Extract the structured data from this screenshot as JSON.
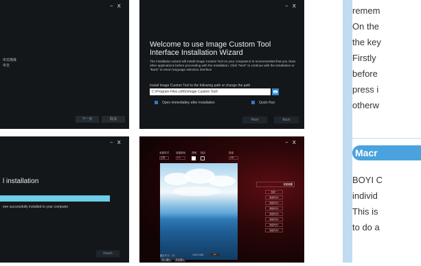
{
  "panel1": {
    "window_controls": [
      "–",
      "x"
    ],
    "language_lines": [
      "中文简体",
      "中文"
    ],
    "buttons": [
      "下一步",
      "取消"
    ]
  },
  "panel2": {
    "window_controls": [
      "–",
      "x"
    ],
    "title": "Welcome to use Image Custom Tool Interface Installation Wizard",
    "description": "The installation wizard will install Image Custom Tool on your computer,It is recommended that you close other applications before proceeding with the Installation,  Click \"Next\" to continue with the Installation or \"Back\" to return language selection interface",
    "path_label": "Install Image Custom Tool to the following path or change the path",
    "path_value": "C:\\Program Files (x86)\\Image Custom Tool\\",
    "checkbox_open": "Open immediatley after installation",
    "checkbox_quick": "Quick Run",
    "next_label": "Next",
    "back_label": "Back"
  },
  "panel3": {
    "window_controls": [
      "–",
      "x"
    ],
    "title": "l installation",
    "message": "een successfully installed to your computer",
    "progress": 1.0,
    "finish_label": "Finish"
  },
  "panel4": {
    "window_controls": [
      "–",
      "x"
    ],
    "toolbar_labels": [
      "准星样式",
      "准星颜色",
      "透明",
      "描边",
      "类型"
    ],
    "toolbar_values": [
      "正常",
      "1.0",
      "100"
    ],
    "side_header": "准星设置",
    "side_header_right": "十字准星",
    "side_items": [
      "准星一",
      "准星样式2",
      "准星样式3",
      "准星样式4",
      "准星样式5",
      "准星样式6",
      "准星样式7",
      "准星样式8"
    ],
    "stat_left": "图片尺寸：2/1",
    "stat_right": "1920*1080",
    "stat_unit": "px",
    "bottom_buttons": [
      "导入图片",
      "导出图片"
    ]
  },
  "right_text": {
    "lines_top": [
      "remem",
      "On the",
      "the key",
      "Firstly",
      "before",
      "press i",
      "otherw"
    ],
    "macro_heading": "Macr",
    "lines_bottom": [
      "BOYI C",
      "individ",
      "This is",
      "to do a"
    ]
  },
  "colors": {
    "accent_blue": "#4aa3de",
    "side_bar": "#bfdcf2",
    "panel_bg": "#14171a",
    "progress": "#6ccde8"
  }
}
